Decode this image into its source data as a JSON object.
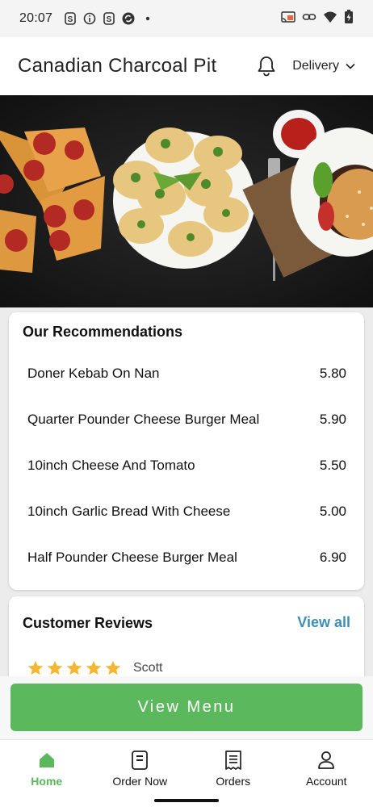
{
  "status_bar": {
    "time": "20:07",
    "left_icons": [
      "s-app-icon",
      "info-icon",
      "s-app-icon",
      "sync-icon",
      "dot-icon"
    ],
    "right_icons": [
      "cast-icon",
      "link-icon",
      "wifi-icon",
      "battery-icon"
    ]
  },
  "header": {
    "title": "Canadian Charcoal Pit",
    "delivery_label": "Delivery"
  },
  "recommendations": {
    "title": "Our Recommendations",
    "items": [
      {
        "name": "Doner Kebab On Nan",
        "price": "5.80"
      },
      {
        "name": "Quarter Pounder Cheese Burger Meal",
        "price": "5.90"
      },
      {
        "name": "10inch Cheese And Tomato",
        "price": "5.50"
      },
      {
        "name": "10inch Garlic Bread With Cheese",
        "price": "5.00"
      },
      {
        "name": "Half Pounder Cheese Burger Meal",
        "price": "6.90"
      }
    ]
  },
  "reviews": {
    "title": "Customer Reviews",
    "view_all": "View all",
    "first_review": {
      "rating": 5,
      "author": "Scott"
    }
  },
  "cta": {
    "label": "View Menu"
  },
  "nav": {
    "items": [
      {
        "label": "Home",
        "icon": "home-icon",
        "active": true
      },
      {
        "label": "Order Now",
        "icon": "order-now-icon",
        "active": false
      },
      {
        "label": "Orders",
        "icon": "receipt-icon",
        "active": false
      },
      {
        "label": "Account",
        "icon": "account-icon",
        "active": false
      }
    ]
  },
  "colors": {
    "accent_green": "#5cb85c",
    "link_blue": "#3e8fb7",
    "star_gold": "#f5b731"
  }
}
